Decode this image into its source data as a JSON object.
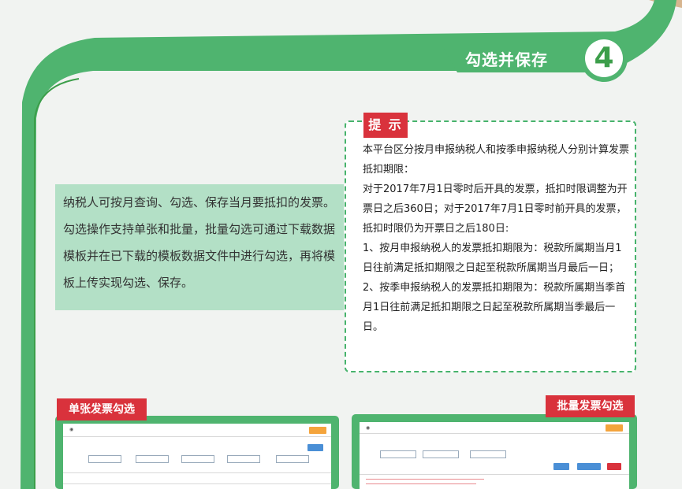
{
  "section": {
    "title": "勾选并保存",
    "number": "4"
  },
  "description": "纳税人可按月查询、勾选、保存当月要抵扣的发票。勾选操作支持单张和批量，批量勾选可通过下载数据模板并在已下载的模板数据文件中进行勾选，再将模板上传实现勾选、保存。",
  "tip": {
    "label": "提 示",
    "lines": [
      "本平台区分按月申报纳税人和按季申报纳税人分别计算发票抵扣期限：",
      "对于2017年7月1日零时后开具的发票，抵扣时限调整为开票日之后360日；对于2017年7月1日零时前开具的发票，抵扣时限仍为开票日之后180日:",
      "1、按月申报纳税人的发票抵扣期限为：税款所属期当月1日往前满足抵扣期限之日起至税款所属期当月最后一日；",
      "2、按季申报纳税人的发票抵扣期限为：税款所属期当季首月1日往前满足抵扣期限之日起至税款所属期当季最后一日。"
    ]
  },
  "screenshots": {
    "single_label": "单张发票勾选",
    "batch_label": "批量发票勾选"
  },
  "colors": {
    "green": "#4fb46f",
    "dark_green": "#3c9e4a",
    "light_green": "#b3e0c6",
    "red": "#d9323c",
    "background": "#f1f3f1"
  }
}
